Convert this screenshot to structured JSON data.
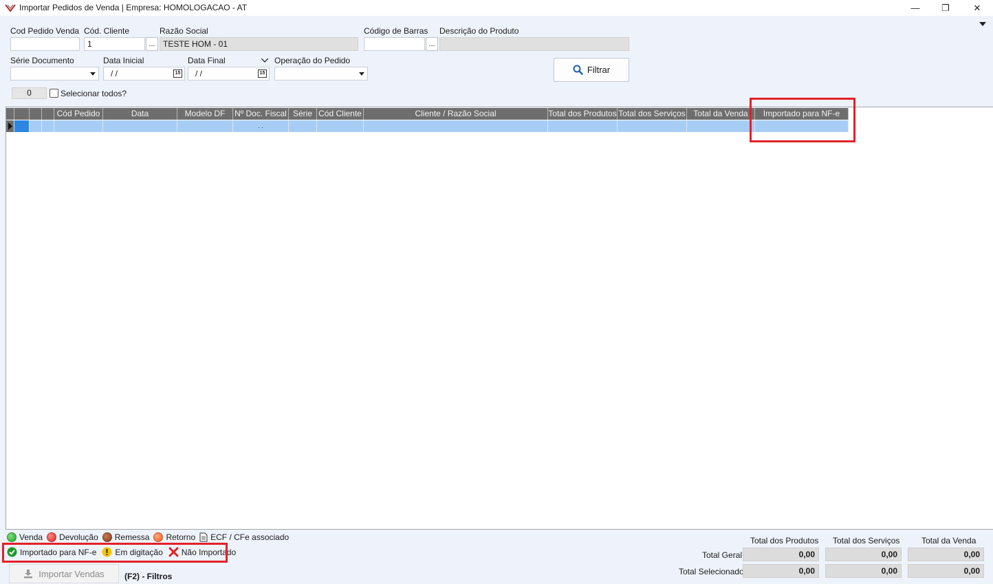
{
  "window": {
    "title": "Importar Pedidos de Venda | Empresa: HOMOLOGACAO - AT",
    "minimize_glyph": "—",
    "restore_glyph": "❐",
    "close_glyph": "✕"
  },
  "filters": {
    "cod_pedido_label": "Cod Pedido Venda",
    "cod_pedido_value": "",
    "cod_cliente_label": "Cód. Cliente",
    "cod_cliente_value": "1",
    "lookup_label": "...",
    "razao_social_label": "Razão Social",
    "razao_social_value": "TESTE HOM - 01",
    "codigo_barras_label": "Código de Barras",
    "codigo_barras_value": "",
    "descricao_produto_label": "Descrição do Produto",
    "descricao_produto_value": "",
    "serie_documento_label": "Série Documento",
    "serie_documento_value": "",
    "data_inicial_label": "Data Inicial",
    "data_inicial_value": " / /",
    "data_final_label": "Data Final",
    "data_final_value": " / /",
    "operacao_pedido_label": "Operação do Pedido",
    "operacao_pedido_value": "",
    "calendar_glyph": "15",
    "filtrar_label": "Filtrar",
    "selected_count": "0",
    "selecionar_todos_label": "Selecionar todos?"
  },
  "grid": {
    "columns": [
      "",
      "",
      "",
      "Cód Pedido",
      "Data",
      "Modelo DF",
      "Nº Doc. Fiscal",
      "Série",
      "Cód Cliente",
      "Cliente / Razão Social",
      "Total dos Produtos",
      "Total dos Serviços",
      "Total da Venda",
      "Importado para NF-e"
    ],
    "rows": [
      [
        "",
        "",
        "",
        "",
        "",
        "",
        ". .",
        "",
        "",
        "",
        "",
        "",
        "",
        ""
      ]
    ]
  },
  "legend": {
    "row1": [
      {
        "label": "Venda",
        "color": "#1fa51f"
      },
      {
        "label": "Devolução",
        "color": "#e32020"
      },
      {
        "label": "Remessa",
        "color": "#8b3a1a"
      },
      {
        "label": "Retorno",
        "color": "#f25a1c"
      },
      {
        "label": "ECF / CFe associado",
        "icon": "document-icon"
      }
    ],
    "row2": [
      {
        "label": "Importado para NF-e",
        "icon": "check-circle-icon",
        "color": "#1f9a2a"
      },
      {
        "label": "Em digitação",
        "icon": "warning-circle-icon",
        "color": "#f5c400"
      },
      {
        "label": "Não Importado",
        "icon": "x-icon",
        "color": "#e32020"
      }
    ]
  },
  "footer": {
    "importar_vendas_label": "Importar Vendas",
    "f2_filtros_label": "(F2) - Filtros",
    "totals_headers": [
      "Total dos Produtos",
      "Total dos Serviços",
      "Total da Venda"
    ],
    "total_geral_label": "Total Geral",
    "total_geral_values": [
      "0,00",
      "0,00",
      "0,00"
    ],
    "total_selecionado_label": "Total Selecionado",
    "total_selecionado_values": [
      "0,00",
      "0,00",
      "0,00"
    ]
  },
  "colors": {
    "highlight": "#e3202b",
    "grid_header": "#6e6e6e",
    "selected_row": "#a8cdf5"
  }
}
